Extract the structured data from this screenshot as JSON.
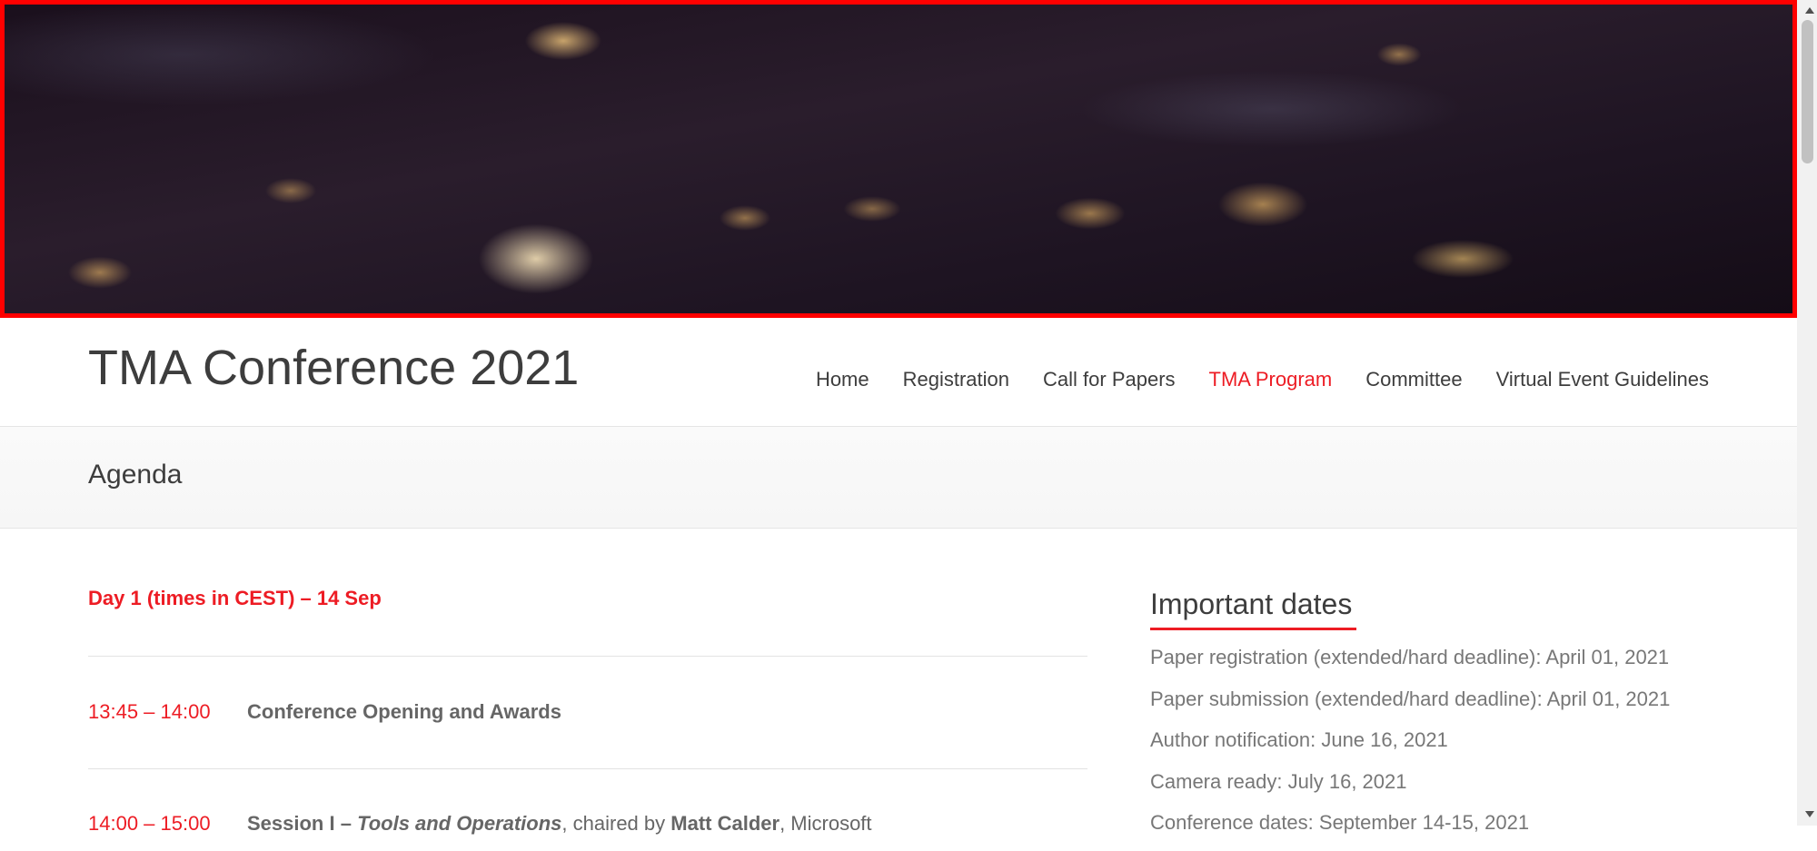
{
  "header": {
    "site_title": "TMA Conference 2021",
    "nav": [
      {
        "label": "Home",
        "active": false
      },
      {
        "label": "Registration",
        "active": false
      },
      {
        "label": "Call for Papers",
        "active": false
      },
      {
        "label": "TMA Program",
        "active": true
      },
      {
        "label": "Committee",
        "active": false
      },
      {
        "label": "Virtual Event Guidelines",
        "active": false
      }
    ]
  },
  "page": {
    "title": "Agenda"
  },
  "agenda": {
    "day_heading": "Day 1 (times in CEST) – 14 Sep",
    "rows": [
      {
        "time": "13:45 – 14:00",
        "title": "Conference Opening and Awards"
      },
      {
        "time": "14:00 – 15:00",
        "session": "Session I –",
        "topic": "Tools and Operations",
        "chaired_by": ", chaired by",
        "chair": "Matt Calder",
        "affiliation": ", Microsoft"
      }
    ]
  },
  "sidebar": {
    "widget_title": "Important dates",
    "dates": [
      "Paper registration (extended/hard deadline): April 01, 2021",
      "Paper submission (extended/hard deadline): April 01, 2021",
      "Author notification: June 16, 2021",
      "Camera ready: July 16, 2021",
      "Conference dates: September 14-15, 2021"
    ]
  },
  "colors": {
    "accent": "#ed1c24",
    "text": "#3d3d3d",
    "muted": "#777777"
  }
}
